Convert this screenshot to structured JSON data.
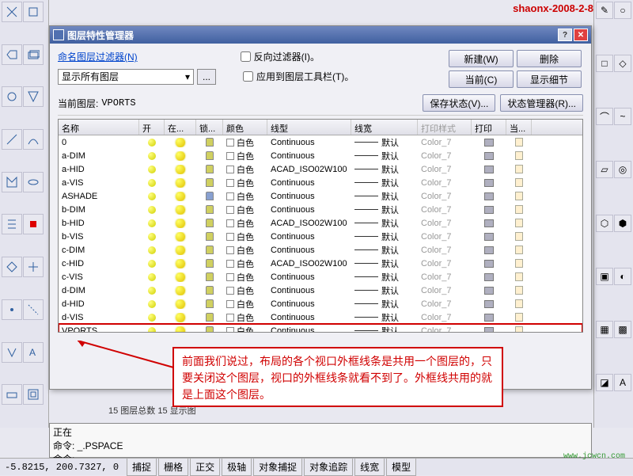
{
  "watermark": "shaonx-2008-2-8",
  "dialog": {
    "title": "图层特性管理器",
    "filter_link": "命名图层过滤器(N)",
    "filter_value": "显示所有图层",
    "chk_invert": "反向过滤器(I)。",
    "chk_toolbar": "应用到图层工具栏(T)。",
    "btn_new": "新建(W)",
    "btn_delete": "删除",
    "btn_current": "当前(C)",
    "btn_detail": "显示细节",
    "current_label": "当前图层:",
    "current_value": "VPORTS",
    "btn_savestate": "保存状态(V)...",
    "btn_statemgr": "状态管理器(R)...",
    "headers": {
      "name": "名称",
      "on": "开",
      "freeze": "在...",
      "lock": "锁...",
      "color": "颜色",
      "ltype": "线型",
      "lweight": "线宽",
      "pstyle": "打印样式",
      "plot": "打印",
      "cur": "当..."
    },
    "rows": [
      {
        "name": "0",
        "color": "白色",
        "ltype": "Continuous",
        "lw": "默认",
        "ps": "Color_7"
      },
      {
        "name": "a-DIM",
        "color": "白色",
        "ltype": "Continuous",
        "lw": "默认",
        "ps": "Color_7"
      },
      {
        "name": "a-HID",
        "color": "白色",
        "ltype": "ACAD_ISO02W100",
        "lw": "默认",
        "ps": "Color_7"
      },
      {
        "name": "a-VIS",
        "color": "白色",
        "ltype": "Continuous",
        "lw": "默认",
        "ps": "Color_7"
      },
      {
        "name": "ASHADE",
        "color": "白色",
        "ltype": "Continuous",
        "lw": "默认",
        "ps": "Color_7",
        "locked": true
      },
      {
        "name": "b-DIM",
        "color": "白色",
        "ltype": "Continuous",
        "lw": "默认",
        "ps": "Color_7"
      },
      {
        "name": "b-HID",
        "color": "白色",
        "ltype": "ACAD_ISO02W100",
        "lw": "默认",
        "ps": "Color_7"
      },
      {
        "name": "b-VIS",
        "color": "白色",
        "ltype": "Continuous",
        "lw": "默认",
        "ps": "Color_7"
      },
      {
        "name": "c-DIM",
        "color": "白色",
        "ltype": "Continuous",
        "lw": "默认",
        "ps": "Color_7"
      },
      {
        "name": "c-HID",
        "color": "白色",
        "ltype": "ACAD_ISO02W100",
        "lw": "默认",
        "ps": "Color_7"
      },
      {
        "name": "c-VIS",
        "color": "白色",
        "ltype": "Continuous",
        "lw": "默认",
        "ps": "Color_7"
      },
      {
        "name": "d-DIM",
        "color": "白色",
        "ltype": "Continuous",
        "lw": "默认",
        "ps": "Color_7"
      },
      {
        "name": "d-HID",
        "color": "白色",
        "ltype": "Continuous",
        "lw": "默认",
        "ps": "Color_7"
      },
      {
        "name": "d-VIS",
        "color": "白色",
        "ltype": "Continuous",
        "lw": "默认",
        "ps": "Color_7"
      },
      {
        "name": "VPORTS",
        "color": "白色",
        "ltype": "Continuous",
        "lw": "默认",
        "ps": "Color_7",
        "highlight": true
      }
    ],
    "status": "15 图层总数     15 显示图"
  },
  "callout": "前面我们说过，布局的各个视口外框线条是共用一个图层的，只要关闭这个图层，视口的外框线条就看不到了。外框线共用的就是上面这个图层。",
  "cmdline": {
    "l1": "正在",
    "l2": "命令: _.PSPACE",
    "l3": "命令:"
  },
  "coords": "-5.8215, 200.7327, 0",
  "modes": [
    "捕捉",
    "栅格",
    "正交",
    "极轴",
    "对象捕捉",
    "对象追踪",
    "线宽",
    "模型"
  ],
  "corner_url": "www.jcwcn.com"
}
